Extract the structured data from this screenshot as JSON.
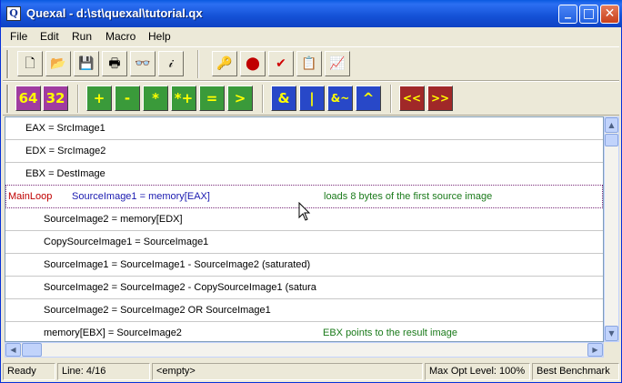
{
  "window": {
    "title": "Quexal - d:\\st\\quexal\\tutorial.qx",
    "app_icon_glyph": "Q"
  },
  "title_buttons": {
    "minimize": "_",
    "maximize": "□",
    "close": "✕"
  },
  "menu": [
    "File",
    "Edit",
    "Run",
    "Macro",
    "Help"
  ],
  "toolbar1": {
    "icons": [
      "new-file-icon",
      "open-folder-icon",
      "save-disk-icon",
      "print-icon",
      "find-binoculars-icon",
      "info-icon",
      "key-icon",
      "record-icon",
      "check-icon",
      "export-icon",
      "graph-icon"
    ],
    "glyphs": [
      "🗋",
      "📂",
      "💾",
      "🖶",
      "👓",
      "𝒾",
      "🔑",
      "⬤",
      "✔",
      "📋",
      "📈"
    ]
  },
  "toolbar2": {
    "purple": [
      "64",
      "32"
    ],
    "green": [
      "+",
      "-",
      "*",
      "*+",
      "=",
      ">"
    ],
    "blue": [
      "&",
      "|",
      "&~",
      "^"
    ],
    "red": [
      "<<",
      ">>"
    ]
  },
  "editor": {
    "rows": [
      {
        "label": "",
        "code": "EAX = SrcImage1",
        "comment": "",
        "indent": "top"
      },
      {
        "label": "",
        "code": "EDX = SrcImage2",
        "comment": "",
        "indent": "top"
      },
      {
        "label": "",
        "code": "EBX = DestImage",
        "comment": "",
        "indent": "top"
      },
      {
        "label": "MainLoop",
        "code": "SourceImage1 = memory[EAX]",
        "comment": "loads 8 bytes of the first source image",
        "indent": "active"
      },
      {
        "label": "",
        "code": "SourceImage2 = memory[EDX]",
        "comment": "",
        "indent": "loop"
      },
      {
        "label": "",
        "code": "CopySourceImage1 = SourceImage1",
        "comment": "",
        "indent": "loop"
      },
      {
        "label": "",
        "code": "SourceImage1 = SourceImage1 - SourceImage2 (saturated)",
        "comment": "",
        "indent": "loop"
      },
      {
        "label": "",
        "code": "SourceImage2 = SourceImage2 - CopySourceImage1 (satura",
        "comment": "",
        "indent": "loop"
      },
      {
        "label": "",
        "code": "SourceImage2 = SourceImage2 OR SourceImage1",
        "comment": "",
        "indent": "loop"
      },
      {
        "label": "",
        "code": "memory[EBX] = SourceImage2",
        "comment": "EBX points to the result image",
        "indent": "loop"
      }
    ]
  },
  "status": {
    "state": "Ready",
    "line": "Line: 4/16",
    "buffer": "<empty>",
    "opt_level": "Max Opt Level: 100%",
    "benchmark": "Best Benchmark"
  }
}
